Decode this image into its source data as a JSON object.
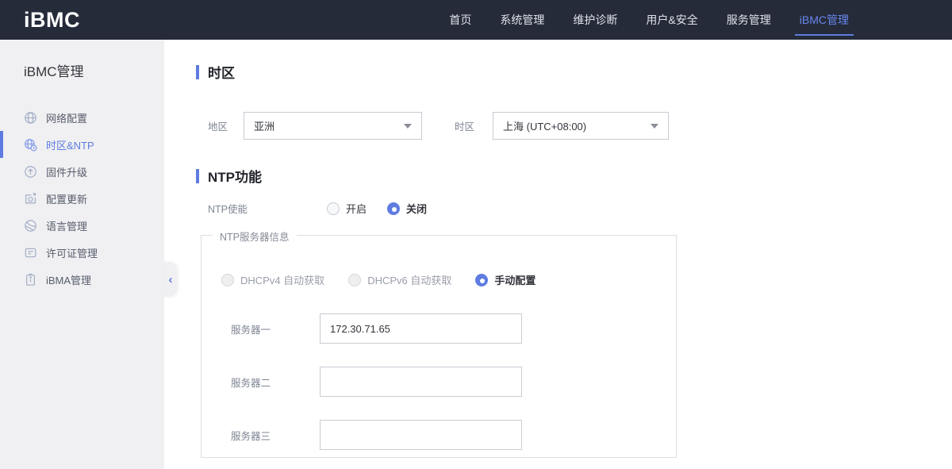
{
  "header": {
    "logo": "iBMC",
    "nav": {
      "items": [
        {
          "label": "首页",
          "active": false
        },
        {
          "label": "系统管理",
          "active": false
        },
        {
          "label": "维护诊断",
          "active": false
        },
        {
          "label": "用户&安全",
          "active": false
        },
        {
          "label": "服务管理",
          "active": false
        },
        {
          "label": "iBMC管理",
          "active": true
        }
      ]
    }
  },
  "sidebar": {
    "title": "iBMC管理",
    "items": [
      {
        "label": "网络配置",
        "icon": "globe-icon",
        "active": false
      },
      {
        "label": "时区&NTP",
        "icon": "globe-clock-icon",
        "active": true
      },
      {
        "label": "固件升级",
        "icon": "upgrade-circle-icon",
        "active": false
      },
      {
        "label": "配置更新",
        "icon": "config-update-icon",
        "active": false
      },
      {
        "label": "语言管理",
        "icon": "language-icon",
        "active": false
      },
      {
        "label": "许可证管理",
        "icon": "license-icon",
        "active": false
      },
      {
        "label": "iBMA管理",
        "icon": "clipboard-icon",
        "active": false
      }
    ],
    "collapse_icon": "‹"
  },
  "main": {
    "timezone_section": {
      "title": "时区",
      "region": {
        "label": "地区",
        "value": "亚洲"
      },
      "timezone": {
        "label": "时区",
        "value": "上海 (UTC+08:00)"
      }
    },
    "ntp_section": {
      "title": "NTP功能",
      "enable": {
        "label": "NTP使能",
        "options": [
          {
            "label": "开启",
            "checked": false
          },
          {
            "label": "关闭",
            "checked": true
          }
        ]
      },
      "server_group": {
        "legend": "NTP服务器信息",
        "modes": [
          {
            "label": "DHCPv4 自动获取",
            "checked": false,
            "disabled": true
          },
          {
            "label": "DHCPv6 自动获取",
            "checked": false,
            "disabled": true
          },
          {
            "label": "手动配置",
            "checked": true,
            "disabled": false
          }
        ],
        "servers": [
          {
            "label": "服务器一",
            "value": "172.30.71.65"
          },
          {
            "label": "服务器二",
            "value": ""
          },
          {
            "label": "服务器三",
            "value": ""
          }
        ]
      }
    }
  },
  "colors": {
    "accent": "#5e7ce0",
    "header_bg": "#262b3a",
    "sidebar_bg": "#f0f0f2"
  }
}
